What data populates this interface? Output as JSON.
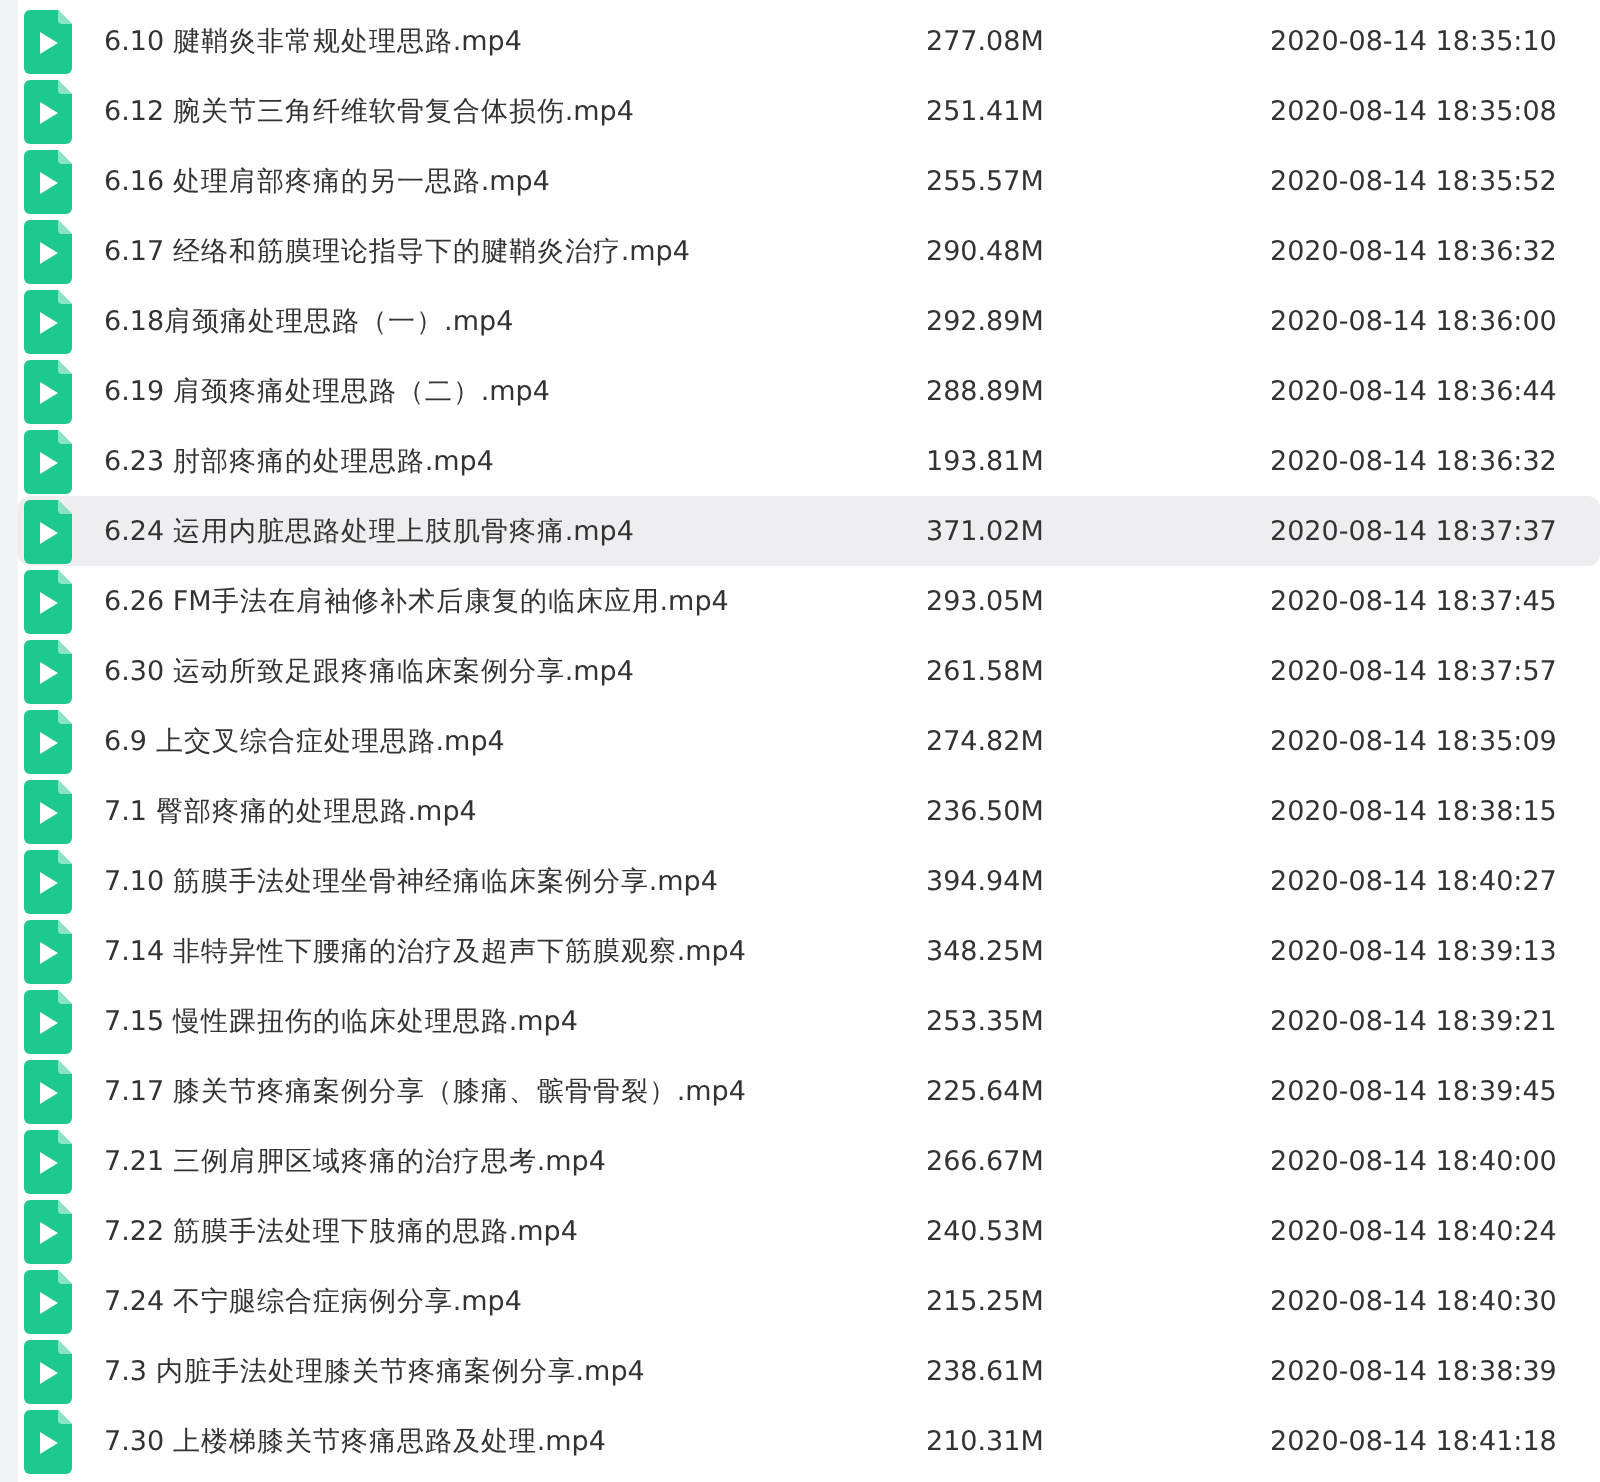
{
  "files": [
    {
      "name": "6.10 腱鞘炎非常规处理思路.mp4",
      "size": "277.08M",
      "modified": "2020-08-14 18:35:10",
      "hovered": false
    },
    {
      "name": "6.12 腕关节三角纤维软骨复合体损伤.mp4",
      "size": "251.41M",
      "modified": "2020-08-14 18:35:08",
      "hovered": false
    },
    {
      "name": "6.16 处理肩部疼痛的另一思路.mp4",
      "size": "255.57M",
      "modified": "2020-08-14 18:35:52",
      "hovered": false
    },
    {
      "name": "6.17 经络和筋膜理论指导下的腱鞘炎治疗.mp4",
      "size": "290.48M",
      "modified": "2020-08-14 18:36:32",
      "hovered": false
    },
    {
      "name": "6.18肩颈痛处理思路（一）.mp4",
      "size": "292.89M",
      "modified": "2020-08-14 18:36:00",
      "hovered": false
    },
    {
      "name": "6.19 肩颈疼痛处理思路（二）.mp4",
      "size": "288.89M",
      "modified": "2020-08-14 18:36:44",
      "hovered": false
    },
    {
      "name": "6.23 肘部疼痛的处理思路.mp4",
      "size": "193.81M",
      "modified": "2020-08-14 18:36:32",
      "hovered": false
    },
    {
      "name": "6.24 运用内脏思路处理上肢肌骨疼痛.mp4",
      "size": "371.02M",
      "modified": "2020-08-14 18:37:37",
      "hovered": true
    },
    {
      "name": "6.26 FM手法在肩袖修补术后康复的临床应用.mp4",
      "size": "293.05M",
      "modified": "2020-08-14 18:37:45",
      "hovered": false
    },
    {
      "name": "6.30 运动所致足跟疼痛临床案例分享.mp4",
      "size": "261.58M",
      "modified": "2020-08-14 18:37:57",
      "hovered": false
    },
    {
      "name": "6.9 上交叉综合症处理思路.mp4",
      "size": "274.82M",
      "modified": "2020-08-14 18:35:09",
      "hovered": false
    },
    {
      "name": "7.1 臀部疼痛的处理思路.mp4",
      "size": "236.50M",
      "modified": "2020-08-14 18:38:15",
      "hovered": false
    },
    {
      "name": "7.10 筋膜手法处理坐骨神经痛临床案例分享.mp4",
      "size": "394.94M",
      "modified": "2020-08-14 18:40:27",
      "hovered": false
    },
    {
      "name": "7.14 非特异性下腰痛的治疗及超声下筋膜观察.mp4",
      "size": "348.25M",
      "modified": "2020-08-14 18:39:13",
      "hovered": false
    },
    {
      "name": "7.15 慢性踝扭伤的临床处理思路.mp4",
      "size": "253.35M",
      "modified": "2020-08-14 18:39:21",
      "hovered": false
    },
    {
      "name": "7.17 膝关节疼痛案例分享（膝痛、髌骨骨裂）.mp4",
      "size": "225.64M",
      "modified": "2020-08-14 18:39:45",
      "hovered": false
    },
    {
      "name": "7.21 三例肩胛区域疼痛的治疗思考.mp4",
      "size": "266.67M",
      "modified": "2020-08-14 18:40:00",
      "hovered": false
    },
    {
      "name": "7.22 筋膜手法处理下肢痛的思路.mp4",
      "size": "240.53M",
      "modified": "2020-08-14 18:40:24",
      "hovered": false
    },
    {
      "name": "7.24 不宁腿综合症病例分享.mp4",
      "size": "215.25M",
      "modified": "2020-08-14 18:40:30",
      "hovered": false
    },
    {
      "name": "7.3 内脏手法处理膝关节疼痛案例分享.mp4",
      "size": "238.61M",
      "modified": "2020-08-14 18:38:39",
      "hovered": false
    },
    {
      "name": "7.30 上楼梯膝关节疼痛思路及处理.mp4",
      "size": "210.31M",
      "modified": "2020-08-14 18:41:18",
      "hovered": false
    }
  ]
}
